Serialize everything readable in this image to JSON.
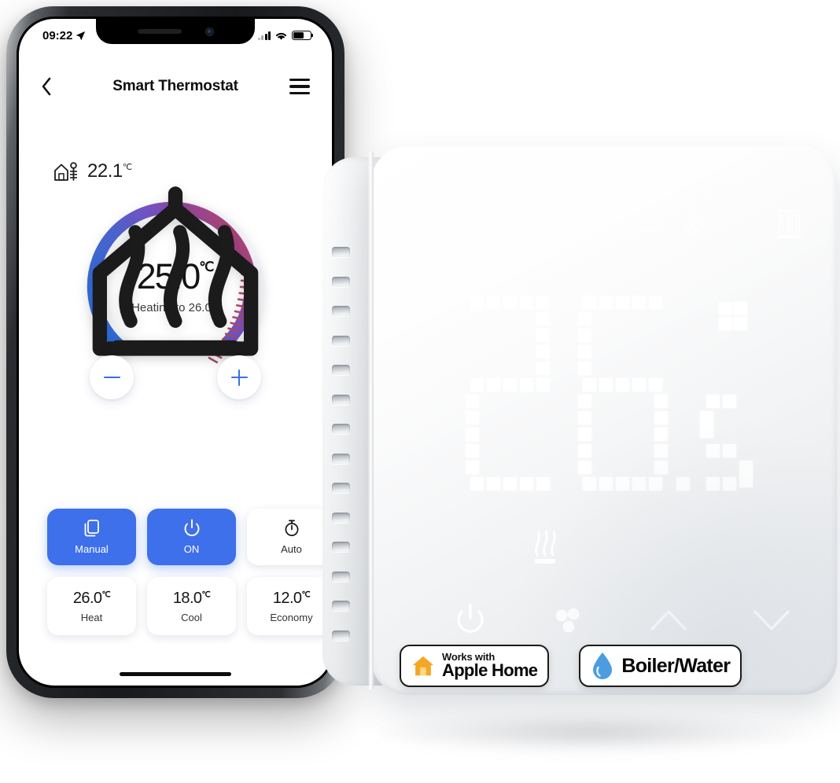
{
  "phone": {
    "status_bar": {
      "time": "09:22",
      "location_icon": "location-arrow-icon",
      "signal_icon": "cellular-signal-icon",
      "wifi_icon": "wifi-icon",
      "battery_icon": "battery-icon"
    },
    "header": {
      "back_icon": "chevron-left-icon",
      "title": "Smart Thermostat",
      "menu_icon": "hamburger-menu-icon"
    },
    "ambient": {
      "icon": "house-radiator-icon",
      "value": "22.1",
      "unit": "℃"
    },
    "dial": {
      "home_icon": "home-icon",
      "current_temp": "25.0",
      "unit": "℃",
      "status_text": "Heating to 26.0",
      "status_unit": "℃",
      "flame_icon": "heat-waves-icon",
      "arc_start_color": "#2f6bd8",
      "arc_mid_color": "#7b4fbe",
      "arc_end_color": "#b4436b",
      "tick_color": "#a94a66",
      "minus_label": "−",
      "plus_label": "+"
    },
    "modes": [
      {
        "label": "Manual",
        "icon": "copy-pages-icon",
        "active": true
      },
      {
        "label": "ON",
        "icon": "power-icon",
        "active": true
      },
      {
        "label": "Auto",
        "icon": "stopwatch-icon",
        "active": false
      }
    ],
    "presets": [
      {
        "value": "26.0",
        "unit": "℃",
        "label": "Heat"
      },
      {
        "value": "18.0",
        "unit": "℃",
        "label": "Cool"
      },
      {
        "value": "12.0",
        "unit": "℃",
        "label": "Economy"
      }
    ],
    "accent_color": "#3d70ea",
    "home_indicator": "home-indicator-bar"
  },
  "device": {
    "status_icons": [
      "wifi-icon",
      "timer-icon",
      "sun-icon",
      "cloud-night-icon",
      "leaf-eco-icon",
      "open-window-icon"
    ],
    "led_display": {
      "value": "26.5",
      "degree_symbol": "°",
      "pixel_color": "#ffffff"
    },
    "flame_icon": "heat-waves-icon",
    "controls": [
      "power-icon",
      "fan-icon",
      "chevron-up-icon",
      "chevron-down-icon"
    ],
    "vent_count": 14
  },
  "badges": [
    {
      "id": "apple-home",
      "icon": "orange-house-icon",
      "superscript": "Works with",
      "main": "Apple Home",
      "icon_color": "#f5a623"
    },
    {
      "id": "boiler-water",
      "icon": "water-drop-icon",
      "main": "Boiler/Water",
      "icon_color": "#4b9ce0"
    }
  ]
}
